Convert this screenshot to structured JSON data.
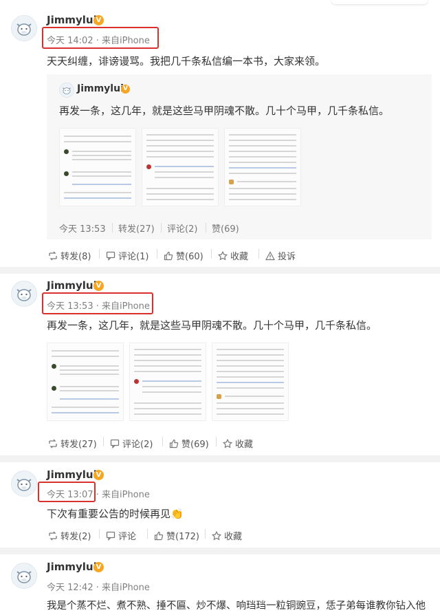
{
  "posts": [
    {
      "username": "Jimmylui",
      "time_source": "今天 14:02 · 来自iPhone",
      "text": "天天纠缠，诽谤谩骂。我把几千条私信编一本书，大家来领。",
      "quote": {
        "username": "Jimmylui",
        "text": "再发一条，这几年，就是这些马甲阴魂不散。几十个马甲，几千条私信。",
        "meta": [
          "今天 13:53",
          "转发(27)",
          "评论(2)",
          "赞(69)"
        ]
      },
      "actions": [
        "转发(8)",
        "评论(1)",
        "赞(60)",
        "收藏",
        "投诉"
      ]
    },
    {
      "username": "Jimmylui",
      "time_source": "今天 13:53 · 来自iPhone",
      "text": "再发一条，这几年，就是这些马甲阴魂不散。几十个马甲，几千条私信。",
      "actions": [
        "转发(27)",
        "评论(2)",
        "赞(69)",
        "收藏"
      ]
    },
    {
      "username": "Jimmylui",
      "time_source": "今天 13:07 · 来自iPhone",
      "text": "下次有重要公告的时候再见",
      "emoji": "👏",
      "actions": [
        "转发(2)",
        "评论",
        "赞(172)",
        "收藏"
      ]
    },
    {
      "username": "Jimmylui",
      "time_source": "今天 12:42 · 来自iPhone",
      "text": "我是个蒸不烂、煮不熟、捶不匾、炒不爆、响珰珰一粒铜豌豆，恁子弟每谁教你钻入他"
    }
  ],
  "icons": {
    "repost": "repost-icon",
    "comment": "comment-icon",
    "like": "like-icon",
    "favorite": "star-icon",
    "report": "warning-icon",
    "verified": "verified-v-icon"
  },
  "colors": {
    "highlight_box": "#d9302e",
    "verified_badge": "#f5a623",
    "separator": "#f2f2f2",
    "quote_background": "#f7f7f7"
  }
}
